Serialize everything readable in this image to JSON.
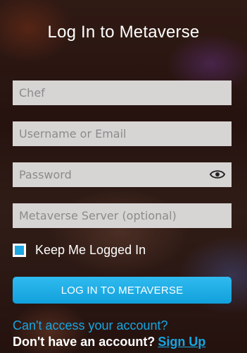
{
  "header": {
    "title": "Log In to Metaverse"
  },
  "form": {
    "display_name": {
      "placeholder": "Chef",
      "value": ""
    },
    "username": {
      "placeholder": "Username or Email",
      "value": ""
    },
    "password": {
      "placeholder": "Password",
      "value": "",
      "toggle_icon": "eye-icon"
    },
    "server": {
      "placeholder": "Metaverse Server (optional)",
      "value": ""
    },
    "keep_logged_in": {
      "label": "Keep Me Logged In",
      "checked": true
    },
    "login_button": {
      "label": "LOG IN TO METAVERSE"
    }
  },
  "footer": {
    "cant_access": "Can't access your account?",
    "no_account": "Don't have an account?",
    "signup": "Sign Up"
  },
  "colors": {
    "accent": "#16a6e2",
    "field_bg": "#d7d5d4",
    "text_light": "#ffffff"
  }
}
